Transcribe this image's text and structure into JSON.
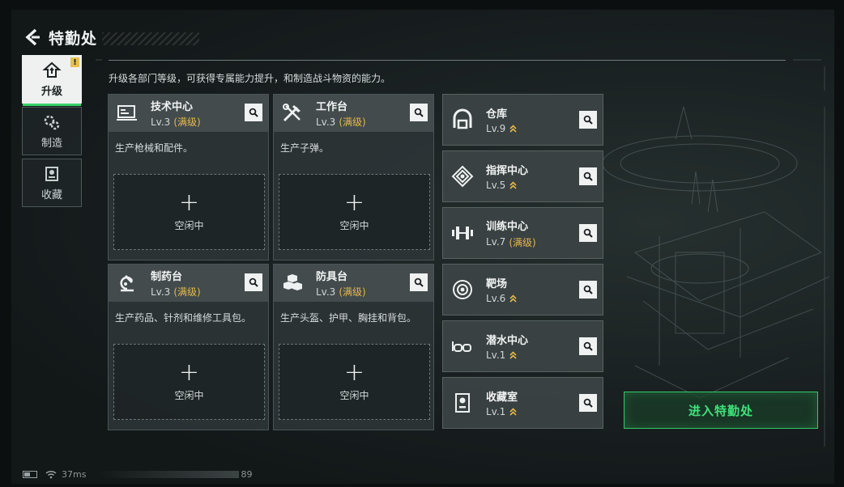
{
  "header": {
    "title": "特勤处"
  },
  "sidebar": {
    "items": [
      {
        "label": "升级",
        "active": true,
        "alert": "!"
      },
      {
        "label": "制造",
        "active": false
      },
      {
        "label": "收藏",
        "active": false
      }
    ]
  },
  "description": "升级各部门等级，可获得专属能力提升，和制造战斗物资的能力。",
  "stations": [
    {
      "name": "技术中心",
      "level": "Lv.3",
      "max": "(满级)",
      "desc": "生产枪械和配件。",
      "slot": "空闲中",
      "icon": "tech-center-icon"
    },
    {
      "name": "工作台",
      "level": "Lv.3",
      "max": "(满级)",
      "desc": "生产子弹。",
      "slot": "空闲中",
      "icon": "workbench-icon"
    },
    {
      "name": "制药台",
      "level": "Lv.3",
      "max": "(满级)",
      "desc": "生产药品、针剂和维修工具包。",
      "slot": "空闲中",
      "icon": "pharmacy-icon"
    },
    {
      "name": "防具台",
      "level": "Lv.3",
      "max": "(满级)",
      "desc": "生产头盔、护甲、胸挂和背包。",
      "slot": "空闲中",
      "icon": "armor-bench-icon"
    }
  ],
  "slot_plus": "+",
  "facilities": [
    {
      "name": "仓库",
      "level": "Lv.9",
      "max": "",
      "upgradable": true,
      "icon": "warehouse-icon"
    },
    {
      "name": "指挥中心",
      "level": "Lv.5",
      "max": "",
      "upgradable": true,
      "icon": "command-center-icon"
    },
    {
      "name": "训练中心",
      "level": "Lv.7",
      "max": "(满级)",
      "upgradable": false,
      "icon": "dumbbell-icon"
    },
    {
      "name": "靶场",
      "level": "Lv.6",
      "max": "",
      "upgradable": true,
      "icon": "target-icon"
    },
    {
      "name": "潜水中心",
      "level": "Lv.1",
      "max": "",
      "upgradable": true,
      "icon": "diving-mask-icon"
    },
    {
      "name": "收藏室",
      "level": "Lv.1",
      "max": "",
      "upgradable": true,
      "icon": "collection-room-icon"
    }
  ],
  "enter_button": "进入特勤处",
  "status": {
    "ping": "37ms",
    "build": "89"
  },
  "colors": {
    "accent_green": "#38d36a",
    "max_gold": "#e5b84a",
    "panel": "#2c3436"
  }
}
